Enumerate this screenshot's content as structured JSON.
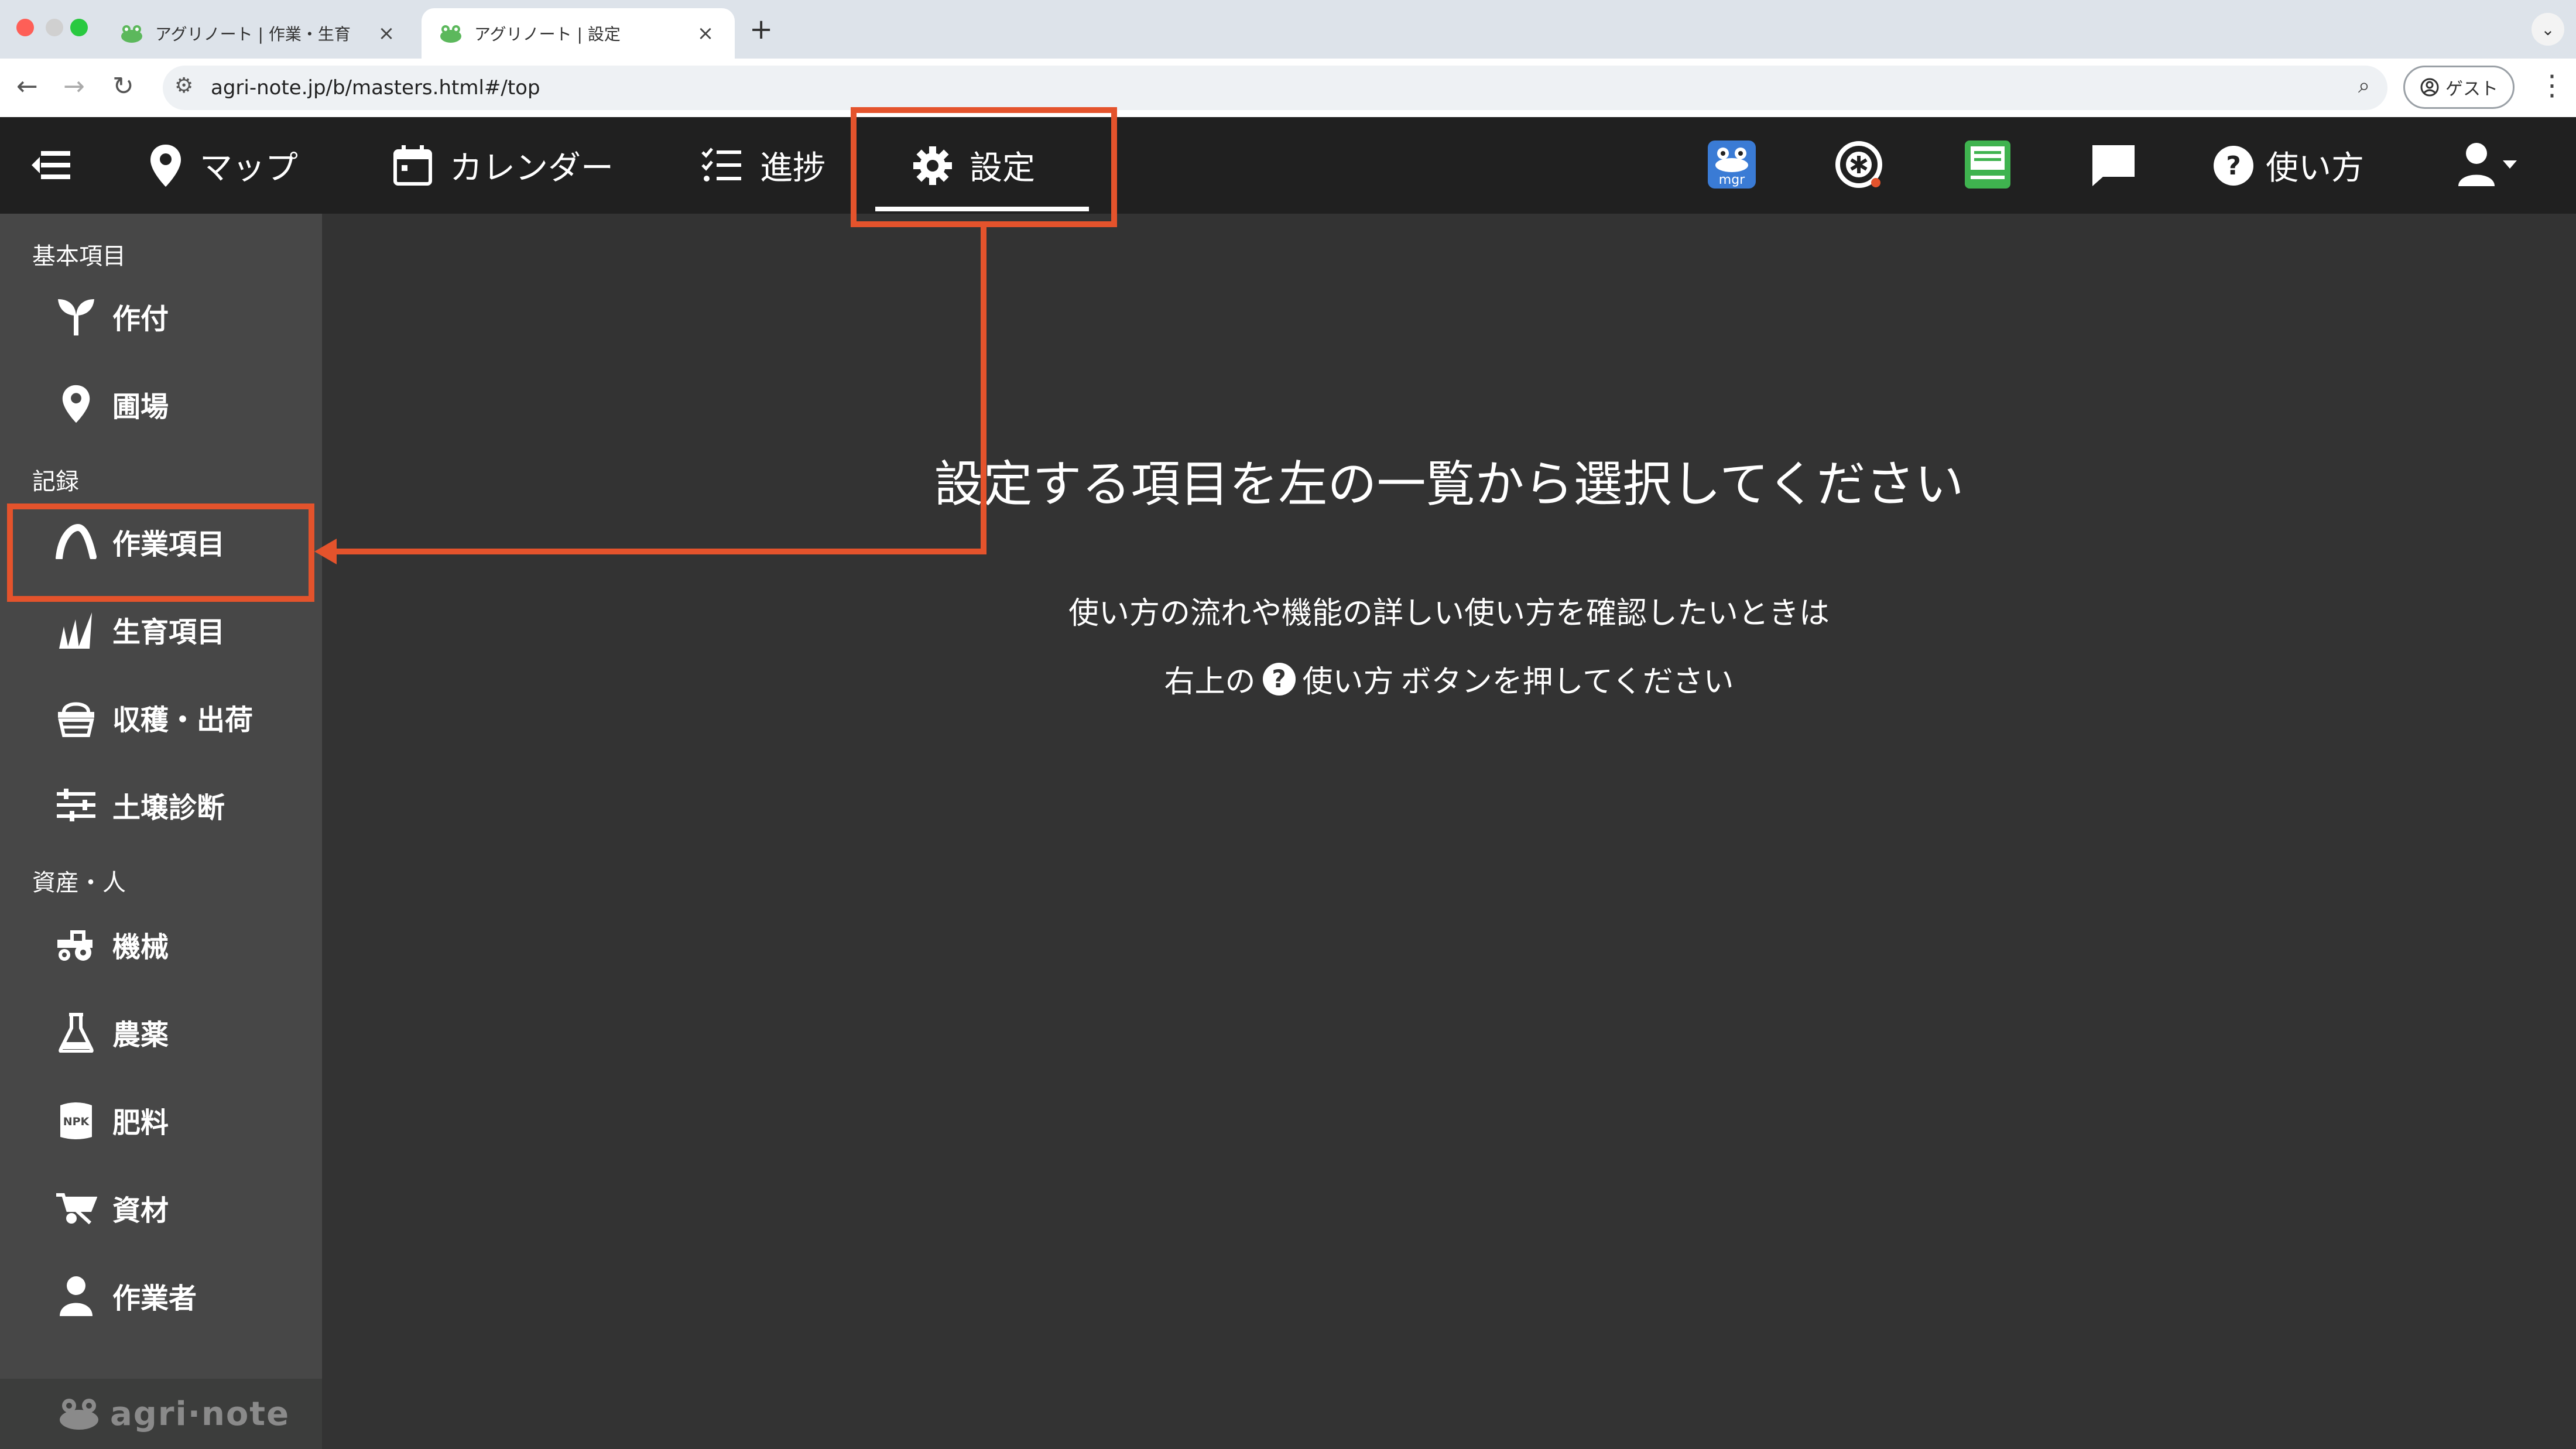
{
  "browser": {
    "tabs": [
      {
        "title": "アグリノート | 作業・生育",
        "active": false
      },
      {
        "title": "アグリノート | 設定",
        "active": true
      }
    ],
    "new_tab_label": "+",
    "tab_close_label": "×",
    "url": "agri-note.jp/b/masters.html#/top",
    "guest_label": "ゲスト"
  },
  "header": {
    "nav": [
      {
        "label": "マップ",
        "icon": "map-pin-icon"
      },
      {
        "label": "カレンダー",
        "icon": "calendar-icon"
      },
      {
        "label": "進捗",
        "icon": "checklist-icon"
      },
      {
        "label": "設定",
        "icon": "gear-icon",
        "active": true
      }
    ],
    "help_label": "使い方",
    "mgr_label": "mgr"
  },
  "sidebar": {
    "sections": [
      {
        "title": "基本項目",
        "items": [
          {
            "label": "作付",
            "icon": "sprout-icon"
          },
          {
            "label": "圃場",
            "icon": "location-pin-icon"
          }
        ]
      },
      {
        "title": "記録",
        "items": [
          {
            "label": "作業項目",
            "icon": "work-arc-icon",
            "highlighted": true
          },
          {
            "label": "生育項目",
            "icon": "growth-icon"
          },
          {
            "label": "収穫・出荷",
            "icon": "basket-icon"
          },
          {
            "label": "土壌診断",
            "icon": "sliders-icon"
          }
        ]
      },
      {
        "title": "資産・人",
        "items": [
          {
            "label": "機械",
            "icon": "tractor-icon"
          },
          {
            "label": "農薬",
            "icon": "flask-icon"
          },
          {
            "label": "肥料",
            "icon": "npk-icon"
          },
          {
            "label": "資材",
            "icon": "wheelbarrow-icon"
          },
          {
            "label": "作業者",
            "icon": "person-icon"
          }
        ]
      }
    ],
    "footer_logo_text": "agri·note"
  },
  "main": {
    "title": "設定する項目を左の一覧から選択してください",
    "line1": "使い方の流れや機能の詳しい使い方を確認したいときは",
    "line2_prefix": "右上の",
    "line2_help": "使い方",
    "line2_suffix": "ボタンを押してください"
  },
  "colors": {
    "highlight": "#e4532c",
    "header_bg": "#202020",
    "sidebar_bg": "#474747",
    "main_bg": "#333333"
  }
}
